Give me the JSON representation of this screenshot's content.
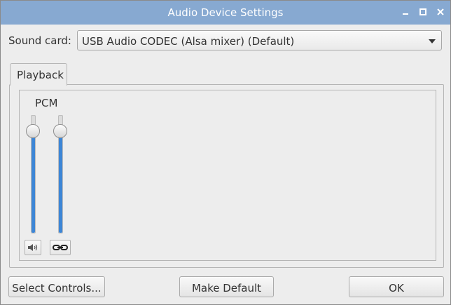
{
  "window": {
    "title": "Audio Device Settings",
    "controls": [
      "minimize-icon",
      "maximize-icon",
      "close-icon"
    ],
    "titlebar_color": "#87a9d1"
  },
  "sound_card": {
    "label": "Sound card:",
    "selected": "USB Audio CODEC (Alsa mixer) (Default)"
  },
  "tabs": [
    {
      "label": "Playback",
      "active": true
    }
  ],
  "mixer": {
    "channel_label": "PCM",
    "sliders": [
      {
        "name": "left",
        "level": 0.95
      },
      {
        "name": "right",
        "level": 0.95
      }
    ],
    "icons": [
      "speaker-icon",
      "link-icon"
    ],
    "accent": "#3d86d6"
  },
  "buttons": {
    "select_controls": "Select Controls...",
    "make_default": "Make Default",
    "ok": "OK"
  }
}
